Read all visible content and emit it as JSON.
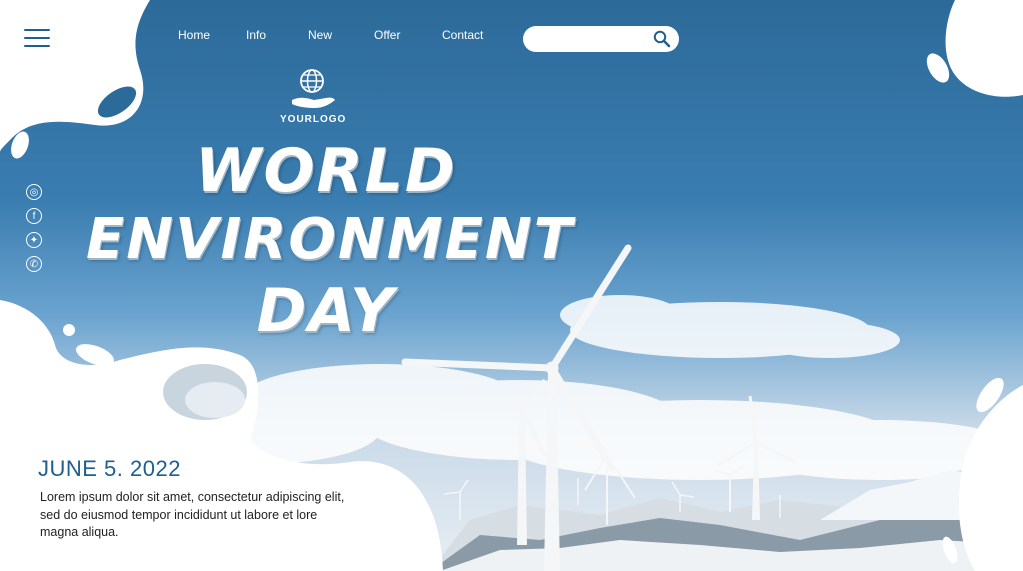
{
  "header": {
    "nav": [
      {
        "label": "Home"
      },
      {
        "label": "Info"
      },
      {
        "label": "New"
      },
      {
        "label": "Offer"
      },
      {
        "label": "Contact"
      }
    ],
    "search": {
      "placeholder": "",
      "value": ""
    }
  },
  "logo": {
    "text": "YOURLOGO"
  },
  "hero": {
    "title_line1": "WORLD",
    "title_line2": "ENVIRONMENT",
    "title_line3": "DAY"
  },
  "social": [
    {
      "icon": "instagram-icon",
      "glyph": "◎"
    },
    {
      "icon": "facebook-icon",
      "glyph": "f"
    },
    {
      "icon": "twitter-icon",
      "glyph": "✦"
    },
    {
      "icon": "whatsapp-icon",
      "glyph": "✆"
    }
  ],
  "event": {
    "date": "JUNE 5. 2022",
    "description": "Lorem ipsum dolor sit amet, consectetur adipiscing elit, sed do eiusmod tempor incididunt ut labore et lore magna aliqua."
  },
  "colors": {
    "accent": "#1e5f8f",
    "sky": "#2f6f9e",
    "blob": "#ffffff"
  }
}
